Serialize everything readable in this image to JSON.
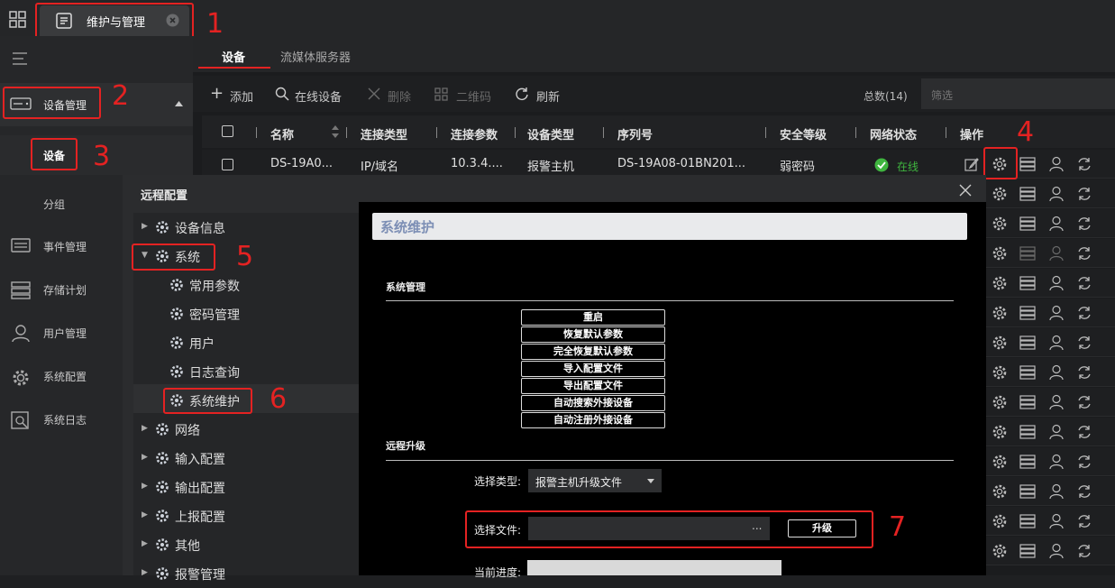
{
  "app": {
    "tab_title": "维护与管理"
  },
  "sidebar": {
    "device_mgmt": "设备管理",
    "device": "设备",
    "group": "分组",
    "items": [
      "事件管理",
      "存储计划",
      "用户管理",
      "系统配置",
      "系统日志"
    ]
  },
  "main_tabs": [
    "设备",
    "流媒体服务器"
  ],
  "toolbar": {
    "add": "添加",
    "online": "在线设备",
    "delete": "删除",
    "qrcode": "二维码",
    "refresh": "刷新",
    "total": "总数(14)",
    "filter_placeholder": "筛选"
  },
  "table": {
    "headers": [
      "名称",
      "连接类型",
      "连接参数",
      "设备类型",
      "序列号",
      "安全等级",
      "网络状态",
      "操作"
    ],
    "row": {
      "name": "DS-19A0...",
      "conn_type": "IP/域名",
      "conn_param": "10.3.4....",
      "dev_type": "报警主机",
      "serial": "DS-19A08-01BN201...",
      "security": "弱密码",
      "status": "在线"
    }
  },
  "markers": [
    "1",
    "2",
    "3",
    "4",
    "5",
    "6",
    "7"
  ],
  "dialog": {
    "title": "远程配置",
    "tree": [
      {
        "label": "设备信息",
        "level": 0
      },
      {
        "label": "系统",
        "level": 0
      },
      {
        "label": "常用参数",
        "level": 1
      },
      {
        "label": "密码管理",
        "level": 1
      },
      {
        "label": "用户",
        "level": 1
      },
      {
        "label": "日志查询",
        "level": 1
      },
      {
        "label": "系统维护",
        "level": 1
      },
      {
        "label": "网络",
        "level": 0
      },
      {
        "label": "输入配置",
        "level": 0
      },
      {
        "label": "输出配置",
        "level": 0
      },
      {
        "label": "上报配置",
        "level": 0
      },
      {
        "label": "其他",
        "level": 0
      },
      {
        "label": "报警管理",
        "level": 0
      }
    ],
    "panel_title": "系统维护",
    "section_mgmt": "系统管理",
    "buttons": [
      "重启",
      "恢复默认参数",
      "完全恢复默认参数",
      "导入配置文件",
      "导出配置文件",
      "自动搜索外接设备",
      "自动注册外接设备"
    ],
    "section_upgrade": "远程升级",
    "select_type_label": "选择类型:",
    "select_type_value": "报警主机升级文件",
    "select_file_label": "选择文件:",
    "browse": "...",
    "upgrade_button": "升级",
    "progress_label": "当前进度:"
  },
  "colors": {
    "accent_red": "#e42222",
    "online_green": "#3fb53f"
  }
}
